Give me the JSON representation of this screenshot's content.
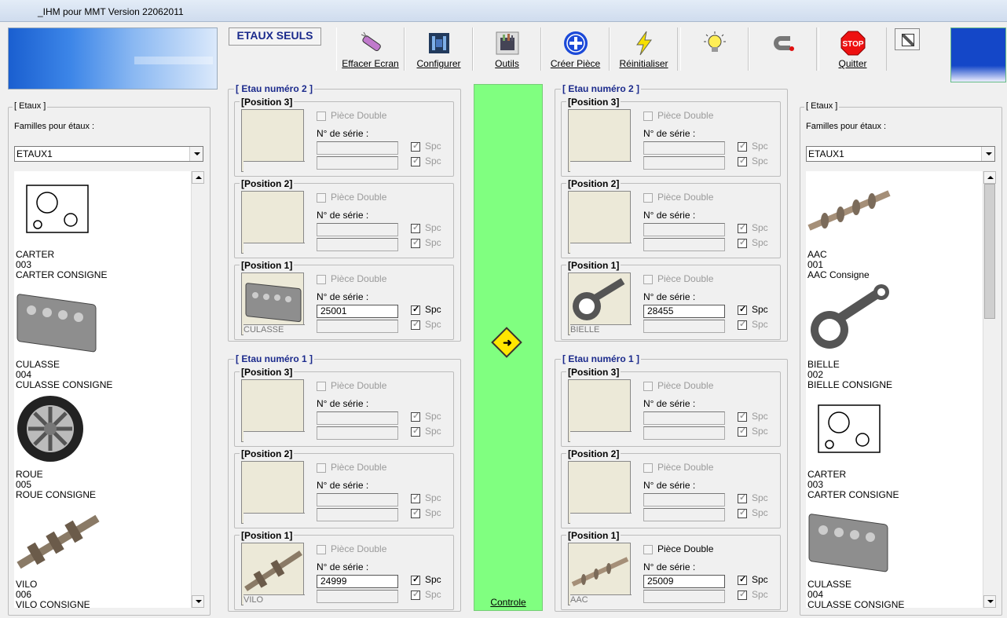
{
  "window": {
    "title": "_IHM pour MMT  Version 22062011"
  },
  "mode_label": "ETAUX SEULS",
  "toolbar": [
    {
      "label": "Effacer Ecran",
      "icon": "eraser-icon"
    },
    {
      "label": "Configurer",
      "icon": "tools-icon"
    },
    {
      "label": "Outils",
      "icon": "toolbox-icon"
    },
    {
      "label": "Créer Pièce",
      "icon": "plus-circle-icon"
    },
    {
      "label": "Réinitialiser",
      "icon": "lightning-icon"
    },
    {
      "label": "",
      "icon": "lightbulb-icon"
    },
    {
      "label": "",
      "icon": "magnet-icon"
    },
    {
      "label": "Quitter",
      "icon": "stop-sign-icon"
    }
  ],
  "left_panel": {
    "group_title": "[ Etaux ]",
    "families_label": "Familles pour étaux :",
    "family_value": "ETAUX1",
    "items": [
      {
        "name": "CARTER",
        "code": "003",
        "desc": "CARTER CONSIGNE"
      },
      {
        "name": "CULASSE",
        "code": "004",
        "desc": "CULASSE CONSIGNE"
      },
      {
        "name": "ROUE",
        "code": "005",
        "desc": "ROUE CONSIGNE"
      },
      {
        "name": "VILO",
        "code": "006",
        "desc": "VILO CONSIGNE"
      }
    ]
  },
  "right_panel": {
    "group_title": "[ Etaux ]",
    "families_label": "Familles pour étaux :",
    "family_value": "ETAUX1",
    "items": [
      {
        "name": "AAC",
        "code": "001",
        "desc": "AAC Consigne"
      },
      {
        "name": "BIELLE",
        "code": "002",
        "desc": "BIELLE CONSIGNE"
      },
      {
        "name": "CARTER",
        "code": "003",
        "desc": "CARTER CONSIGNE"
      },
      {
        "name": "CULASSE",
        "code": "004",
        "desc": "CULASSE CONSIGNE"
      }
    ]
  },
  "labels": {
    "piece_double": "Pièce Double",
    "serial": "N° de série :",
    "spc": "Spc",
    "controle": "Controle"
  },
  "columns": {
    "left": {
      "etau2": {
        "title": "[ Etau numéro 2 ]",
        "p3": {
          "title": "[Position 3]",
          "part": "",
          "serial": ""
        },
        "p2": {
          "title": "[Position 2]",
          "part": "",
          "serial": ""
        },
        "p1": {
          "title": "[Position 1]",
          "part": "CULASSE",
          "serial": "25001"
        }
      },
      "etau1": {
        "title": "[ Etau numéro 1 ]",
        "p3": {
          "title": "[Position 3]",
          "part": "",
          "serial": ""
        },
        "p2": {
          "title": "[Position 2]",
          "part": "",
          "serial": ""
        },
        "p1": {
          "title": "[Position 1]",
          "part": "VILO",
          "serial": "24999"
        }
      }
    },
    "right": {
      "etau2": {
        "title": "[ Etau numéro 2 ]",
        "p3": {
          "title": "[Position 3]",
          "part": "",
          "serial": ""
        },
        "p2": {
          "title": "[Position 2]",
          "part": "",
          "serial": ""
        },
        "p1": {
          "title": "[Position 1]",
          "part": "BIELLE",
          "serial": "28455"
        }
      },
      "etau1": {
        "title": "[ Etau numéro 1 ]",
        "p3": {
          "title": "[Position 3]",
          "part": "",
          "serial": ""
        },
        "p2": {
          "title": "[Position 2]",
          "part": "",
          "serial": ""
        },
        "p1": {
          "title": "[Position 1]",
          "part": "AAC",
          "serial": "25009"
        }
      }
    }
  }
}
